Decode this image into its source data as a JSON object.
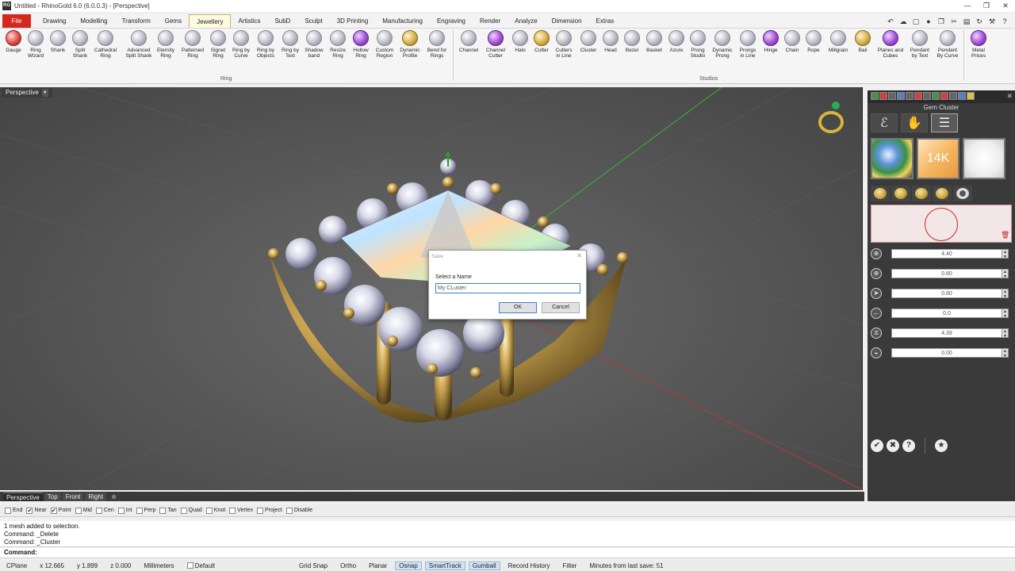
{
  "window": {
    "title": "Untitled - RhinoGold 6.0 (6.0.0.3) - [Perspective]",
    "app_icon": "RG",
    "controls": [
      "—",
      "❐",
      "✕"
    ]
  },
  "menu": {
    "file": "File",
    "items": [
      "Drawing",
      "Modelling",
      "Transform",
      "Gems",
      "Jewellery",
      "Artistics",
      "SubD",
      "Sculpt",
      "3D Printing",
      "Manufacturing",
      "Engraving",
      "Render",
      "Analyze",
      "Dimension",
      "Extras"
    ],
    "active": "Jewellery"
  },
  "ribbon": {
    "group_ring_label": "Ring",
    "group_studios_label": "Studios",
    "ring_tools": [
      {
        "l1": "Gauge",
        "l2": ""
      },
      {
        "l1": "Ring",
        "l2": "Wizard"
      },
      {
        "l1": "Shank",
        "l2": ""
      },
      {
        "l1": "Split",
        "l2": "Shank"
      },
      {
        "l1": "Cathedral",
        "l2": "Ring"
      },
      {
        "l1": "Advanced",
        "l2": "Split Shank"
      },
      {
        "l1": "Eternity",
        "l2": "Ring"
      },
      {
        "l1": "Patterned",
        "l2": "Ring"
      },
      {
        "l1": "Signet",
        "l2": "Ring"
      },
      {
        "l1": "Ring by",
        "l2": "Curve"
      },
      {
        "l1": "Ring by",
        "l2": "Objects"
      },
      {
        "l1": "Ring by",
        "l2": "Text"
      },
      {
        "l1": "Shadow",
        "l2": "band"
      },
      {
        "l1": "Resize",
        "l2": "Ring"
      },
      {
        "l1": "Hollow",
        "l2": "Ring"
      },
      {
        "l1": "Custom",
        "l2": "Region"
      },
      {
        "l1": "Dynamic",
        "l2": "Profile"
      },
      {
        "l1": "Bend for",
        "l2": "Rings"
      }
    ],
    "studio_tools": [
      {
        "l1": "Channel",
        "l2": ""
      },
      {
        "l1": "Channel",
        "l2": "Cutter"
      },
      {
        "l1": "Halo",
        "l2": ""
      },
      {
        "l1": "Cutter",
        "l2": ""
      },
      {
        "l1": "Cutters",
        "l2": "in Line"
      },
      {
        "l1": "Cluster",
        "l2": ""
      },
      {
        "l1": "Head",
        "l2": ""
      },
      {
        "l1": "Bezel",
        "l2": ""
      },
      {
        "l1": "Basket",
        "l2": ""
      },
      {
        "l1": "Azure",
        "l2": ""
      },
      {
        "l1": "Prong",
        "l2": "Studio"
      },
      {
        "l1": "Dynamic",
        "l2": "Prong"
      },
      {
        "l1": "Prongs",
        "l2": "in Line"
      },
      {
        "l1": "Hinge",
        "l2": ""
      },
      {
        "l1": "Chain",
        "l2": ""
      },
      {
        "l1": "Rope",
        "l2": ""
      },
      {
        "l1": "Millgrain",
        "l2": ""
      },
      {
        "l1": "Bail",
        "l2": ""
      },
      {
        "l1": "Planes and",
        "l2": "Cubes"
      },
      {
        "l1": "Pendant",
        "l2": "by Text"
      },
      {
        "l1": "Pendant",
        "l2": "By Curve"
      },
      {
        "l1": "Metal",
        "l2": "Prices"
      }
    ]
  },
  "viewport": {
    "label": "Perspective",
    "dropdown_icon": "▾"
  },
  "dialog": {
    "title": "Save",
    "close": "✕",
    "label": "Select a Name",
    "value": "My CLuster",
    "ok": "OK",
    "cancel": "Cancel"
  },
  "panel": {
    "title": "Gem Cluster",
    "close": "✕",
    "tabs": [
      "ℰ",
      "✋",
      "☰"
    ],
    "thumb2_text": "14K",
    "trash_icon": "🗑",
    "rows": [
      {
        "icon": "⊕",
        "value": "4.40"
      },
      {
        "icon": "⊕",
        "value": "0.80"
      },
      {
        "icon": "➤",
        "value": "0.80"
      },
      {
        "icon": "←",
        "value": "0.0"
      },
      {
        "icon": "⧖",
        "value": "4.39"
      },
      {
        "icon": "◒",
        "value": "0.00"
      }
    ],
    "spin_up": "▲",
    "spin_down": "▼",
    "bottom": [
      "✔",
      "✖",
      "?",
      "★"
    ]
  },
  "view_tabs": [
    "Perspective",
    "Top",
    "Front",
    "Right"
  ],
  "view_tab_plus": "⊕",
  "osnap": [
    {
      "label": "End",
      "checked": false
    },
    {
      "label": "Near",
      "checked": true
    },
    {
      "label": "Point",
      "checked": true
    },
    {
      "label": "Mid",
      "checked": false
    },
    {
      "label": "Cen",
      "checked": false
    },
    {
      "label": "Int",
      "checked": false
    },
    {
      "label": "Perp",
      "checked": false
    },
    {
      "label": "Tan",
      "checked": false
    },
    {
      "label": "Quad",
      "checked": false
    },
    {
      "label": "Knot",
      "checked": false
    },
    {
      "label": "Vertex",
      "checked": false
    },
    {
      "label": "Project",
      "checked": false
    },
    {
      "label": "Disable",
      "checked": false
    }
  ],
  "command_history": [
    "1 mesh added to selection.",
    "Command: _Delete",
    "Command: _Cluster"
  ],
  "command_prompt": "Command:",
  "status": {
    "cplane": "CPlane",
    "x": "x 12.665",
    "y": "y 1.899",
    "z": "z 0.000",
    "units": "Millimeters",
    "layer": "Default",
    "grid_snap": "Grid Snap",
    "ortho": "Ortho",
    "planar": "Planar",
    "osnap": "Osnap",
    "smarttrack": "SmartTrack",
    "gumball": "Gumball",
    "record_history": "Record History",
    "filter": "Filter",
    "last_save": "Minutes from last save: 51"
  }
}
